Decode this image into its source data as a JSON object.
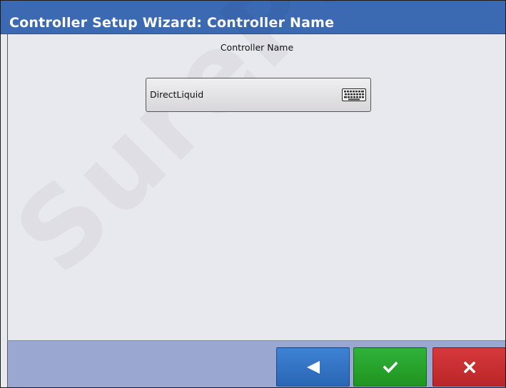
{
  "window": {
    "title": "Controller Setup Wizard:  Controller Name"
  },
  "form": {
    "field_label": "Controller Name",
    "controller_name_value": "DirectLiquid"
  },
  "watermark": {
    "text": "SurePoint"
  },
  "footer": {
    "back_icon": "left-triangle-icon",
    "accept_icon": "checkmark-icon",
    "cancel_icon": "x-icon"
  },
  "colors": {
    "title_bar": "#3b6ab3",
    "back_button": "#3577c7",
    "accept_button": "#28a32e",
    "cancel_button": "#c92f31",
    "footer_bar": "#9aa8d1"
  }
}
